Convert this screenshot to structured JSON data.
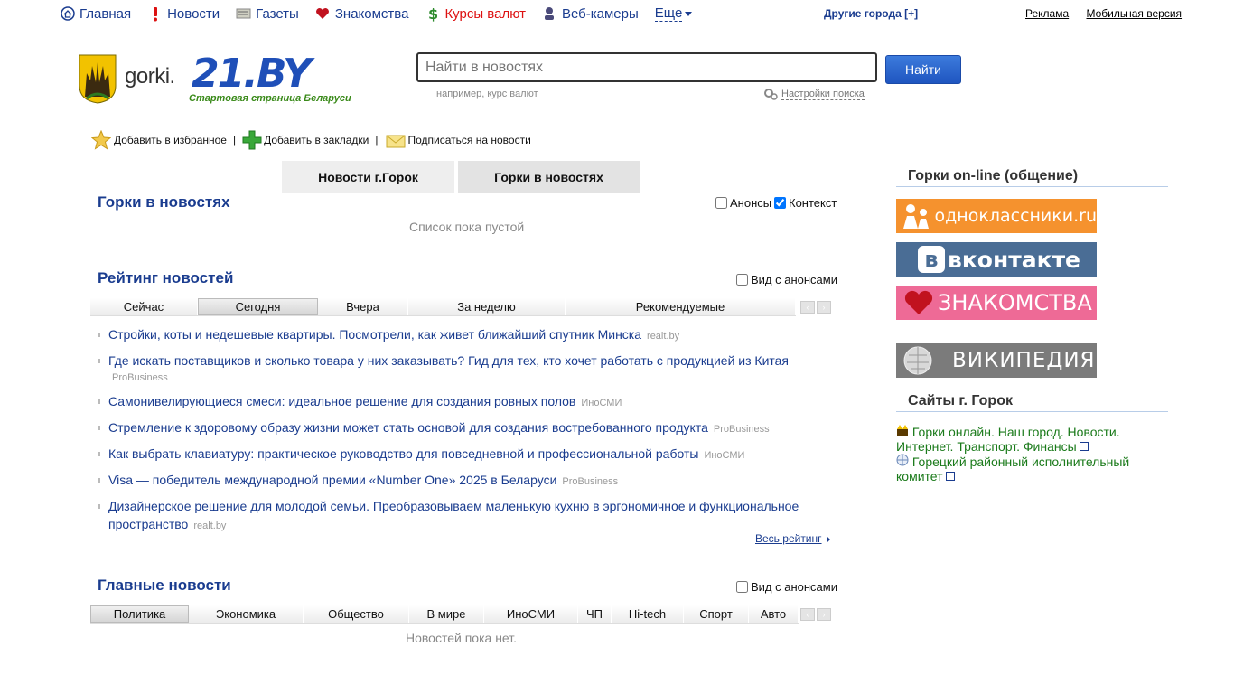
{
  "nav": {
    "items": [
      {
        "label": "Главная",
        "icon": "home-icon"
      },
      {
        "label": "Новости",
        "icon": "exclamation-icon"
      },
      {
        "label": "Газеты",
        "icon": "newspaper-icon"
      },
      {
        "label": "Знакомства",
        "icon": "heart-icon"
      },
      {
        "label": "Курсы валют",
        "icon": "dollar-icon"
      },
      {
        "label": "Веб-камеры",
        "icon": "webcam-icon"
      }
    ],
    "more": "Еще",
    "other_cities": "Другие города [+]",
    "ads": "Реклама",
    "mobile": "Мобильная версия"
  },
  "logo": {
    "city": "gorki.",
    "brand": "21.BY",
    "tagline": "Стартовая страница Беларуси"
  },
  "search": {
    "placeholder": "Найти в новостях",
    "button": "Найти",
    "hint": "например, курс валют",
    "settings": "Настройки поиска"
  },
  "actions": {
    "favorites": "Добавить в избранное",
    "bookmarks": "Добавить в закладки",
    "subscribe": "Подписаться на новости",
    "sep": "|"
  },
  "tabs": {
    "city_news": "Новости г.Горок",
    "in_news": "Горки в новостях"
  },
  "in_news": {
    "title": "Горки в новостях",
    "anons": "Анонсы",
    "context": "Контекст",
    "empty": "Список пока пустой"
  },
  "rating": {
    "title": "Рейтинг новостей",
    "with_anons": "Вид с анонсами",
    "filters": [
      "Сейчас",
      "Сегодня",
      "Вчера",
      "За неделю",
      "Рекомендуемые"
    ],
    "all": "Весь рейтинг",
    "items": [
      {
        "title": "Стройки, коты и недешевые квартиры. Посмотрели, как живет ближайший спутник Минска",
        "source": "realt.by"
      },
      {
        "title": "Где искать поставщиков и сколько товара у них заказывать? Гид для тех, кто хочет работать с продукцией из Китая",
        "source": "ProBusiness"
      },
      {
        "title": "Самонивелирующиеся смеси: идеальное решение для создания ровных полов",
        "source": "ИноСМИ"
      },
      {
        "title": "Стремление к здоровому образу жизни может стать основой для создания востребованного продукта",
        "source": "ProBusiness"
      },
      {
        "title": "Как выбрать клавиатуру: практическое руководство для повседневной и профессиональной работы",
        "source": "ИноСМИ"
      },
      {
        "title": "Visa — победитель международной премии «Number One» 2025 в Беларуси",
        "source": "ProBusiness"
      },
      {
        "title": "Дизайнерское решение для молодой семьи. Преобразовываем маленькую кухню в эргономичное и функциональное пространство",
        "source": "realt.by"
      }
    ]
  },
  "main_news": {
    "title": "Главные новости",
    "with_anons": "Вид с анонсами",
    "filters": [
      "Политика",
      "Экономика",
      "Общество",
      "В мире",
      "ИноСМИ",
      "ЧП",
      "Hi-tech",
      "Спорт",
      "Авто"
    ],
    "empty": "Новостей пока нет."
  },
  "right": {
    "online_title": "Горки on-line (общение)",
    "banners": {
      "ok": "одноклассники.ru",
      "vk": "вконтакте",
      "znak": "ЗНАКОМСТВА",
      "wiki": "ВИКИПЕДИЯ"
    },
    "sites_title": "Сайты г. Горок",
    "sites": [
      "Горки онлайн. Наш город. Новости. Интернет. Транспорт. Финансы",
      "Горецкий районный исполнительный комитет"
    ]
  }
}
